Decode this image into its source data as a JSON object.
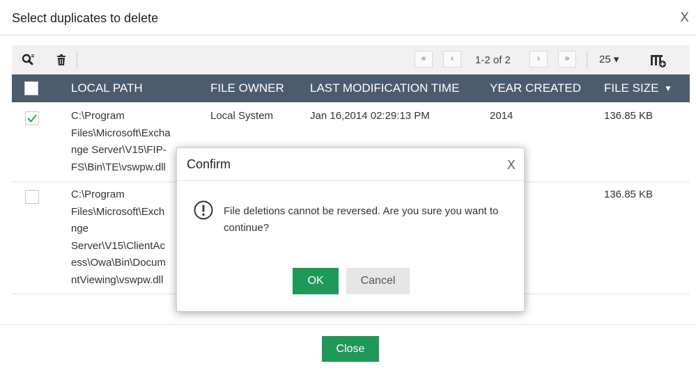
{
  "dialog": {
    "title": "Select duplicates to delete",
    "close_label": "X",
    "close_button_label": "Close"
  },
  "toolbar": {
    "icons": [
      "search-filter-icon",
      "trash-icon",
      "column-settings-icon"
    ],
    "pagination": {
      "first": "«",
      "prev": "‹",
      "info": "1-2 of 2",
      "next": "›",
      "last": "»"
    },
    "per_page": "25 ▾"
  },
  "table": {
    "columns": [
      "LOCAL PATH",
      "FILE OWNER",
      "LAST MODIFICATION TIME",
      "YEAR CREATED",
      "FILE SIZE"
    ],
    "sort_indicator": "▼",
    "rows": [
      {
        "checked": true,
        "path_lines": [
          "C:\\Program",
          "Files\\Microsoft\\Excha",
          "nge Server\\V15\\FIP-",
          "FS\\Bin\\TE\\vswpw.dll"
        ],
        "owner": "Local System",
        "modified": "Jan 16,2014 02:29:13 PM",
        "year": "2014",
        "size": "136.85 KB"
      },
      {
        "checked": false,
        "path_lines": [
          "C:\\Program",
          "Files\\Microsoft\\Exch",
          "nge",
          "Server\\V15\\ClientAc",
          "ess\\Owa\\Bin\\Docum",
          "ntViewing\\vswpw.dll"
        ],
        "owner": "",
        "modified": "",
        "year": "",
        "size": "136.85 KB"
      }
    ]
  },
  "confirm": {
    "title": "Confirm",
    "close_label": "X",
    "message": "File deletions cannot be reversed. Are you sure you want to continue?",
    "ok_label": "OK",
    "cancel_label": "Cancel"
  },
  "colors": {
    "header_bg": "#4b5d6d",
    "primary_button": "#1f9858",
    "check_green": "#3aa651"
  }
}
